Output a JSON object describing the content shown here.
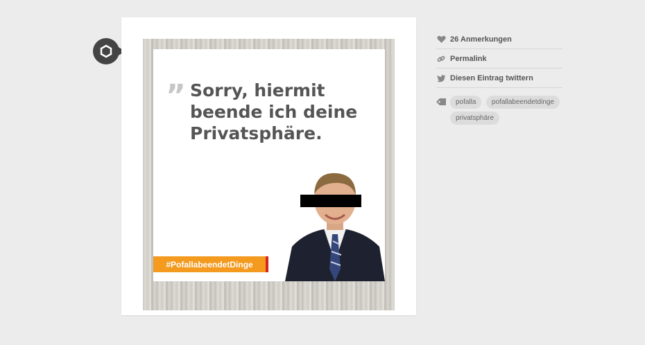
{
  "post": {
    "quote_mark": "”",
    "quote_text": "Sorry, hiermit beende ich deine Privatsphäre.",
    "hashtag": "#PofallabeendetDinge"
  },
  "sidebar": {
    "notes": "26 Anmerkungen",
    "permalink": "Permalink",
    "tweet": "Diesen Eintrag twittern",
    "tags": [
      "pofalla",
      "pofallabeendetdinge",
      "privatsphäre"
    ]
  },
  "icons": {
    "post_type": "photo-post-icon",
    "notes": "heart-icon",
    "permalink": "link-icon",
    "tweet": "twitter-bird-icon",
    "tags": "tag-icon"
  },
  "colors": {
    "banner": "#f39a1f",
    "banner_accent": "#d8261c",
    "badge": "#444444",
    "background": "#ececec"
  }
}
